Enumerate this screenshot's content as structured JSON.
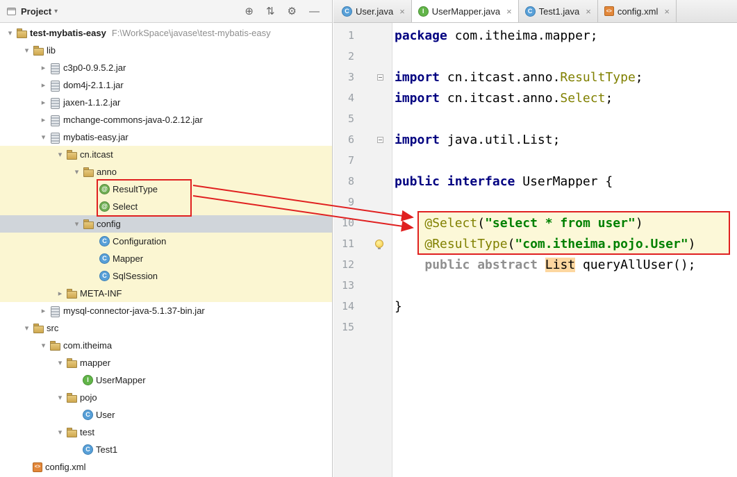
{
  "panel": {
    "title": "Project",
    "header_icons": [
      {
        "name": "locate",
        "glyph": "⊕"
      },
      {
        "name": "collapse-all",
        "glyph": "⇅"
      },
      {
        "name": "settings",
        "glyph": "⚙"
      },
      {
        "name": "hide",
        "glyph": "—"
      }
    ],
    "tree": [
      {
        "label": "test-mybatis-easy",
        "sub": "F:\\WorkSpace\\javase\\test-mybatis-easy",
        "icon": "folder",
        "level": 0,
        "chevron": "expanded",
        "bold": true
      },
      {
        "label": "lib",
        "icon": "folder",
        "level": 1,
        "chevron": "expanded"
      },
      {
        "label": "c3p0-0.9.5.2.jar",
        "icon": "jar",
        "level": 2,
        "chevron": "collapsed"
      },
      {
        "label": "dom4j-2.1.1.jar",
        "icon": "jar",
        "level": 2,
        "chevron": "collapsed"
      },
      {
        "label": "jaxen-1.1.2.jar",
        "icon": "jar",
        "level": 2,
        "chevron": "collapsed"
      },
      {
        "label": "mchange-commons-java-0.2.12.jar",
        "icon": "jar",
        "level": 2,
        "chevron": "collapsed"
      },
      {
        "label": "mybatis-easy.jar",
        "icon": "jar",
        "level": 2,
        "chevron": "expanded"
      },
      {
        "label": "cn.itcast",
        "icon": "folder",
        "level": 3,
        "chevron": "expanded",
        "bg": "yellow"
      },
      {
        "label": "anno",
        "icon": "folder",
        "level": 4,
        "chevron": "expanded",
        "bg": "yellow"
      },
      {
        "label": "ResultType",
        "icon": "annotation",
        "level": 5,
        "bg": "yellow"
      },
      {
        "label": "Select",
        "icon": "annotation",
        "level": 5,
        "bg": "yellow"
      },
      {
        "label": "config",
        "icon": "folder",
        "level": 4,
        "chevron": "expanded",
        "bg": "selected"
      },
      {
        "label": "Configuration",
        "icon": "class",
        "level": 5,
        "bg": "yellow"
      },
      {
        "label": "Mapper",
        "icon": "class",
        "level": 5,
        "bg": "yellow"
      },
      {
        "label": "SqlSession",
        "icon": "class",
        "level": 5,
        "bg": "yellow"
      },
      {
        "label": "META-INF",
        "icon": "folder",
        "level": 3,
        "chevron": "collapsed",
        "bg": "yellow"
      },
      {
        "label": "mysql-connector-java-5.1.37-bin.jar",
        "icon": "jar",
        "level": 2,
        "chevron": "collapsed"
      },
      {
        "label": "src",
        "icon": "folder",
        "level": 1,
        "chevron": "expanded"
      },
      {
        "label": "com.itheima",
        "icon": "folder",
        "level": 2,
        "chevron": "expanded"
      },
      {
        "label": "mapper",
        "icon": "folder",
        "level": 3,
        "chevron": "expanded"
      },
      {
        "label": "UserMapper",
        "icon": "interface",
        "level": 4
      },
      {
        "label": "pojo",
        "icon": "folder",
        "level": 3,
        "chevron": "expanded"
      },
      {
        "label": "User",
        "icon": "class",
        "level": 4
      },
      {
        "label": "test",
        "icon": "folder",
        "level": 3,
        "chevron": "expanded"
      },
      {
        "label": "Test1",
        "icon": "class",
        "level": 4
      },
      {
        "label": "config.xml",
        "icon": "xml",
        "level": 1
      }
    ]
  },
  "tabbar": {
    "close_glyph": "×",
    "tabs": [
      {
        "label": "User.java",
        "icon": "class",
        "active": false
      },
      {
        "label": "UserMapper.java",
        "icon": "interface",
        "active": true
      },
      {
        "label": "Test1.java",
        "icon": "class",
        "active": false
      },
      {
        "label": "config.xml",
        "icon": "xml",
        "active": false
      }
    ]
  },
  "editor": {
    "lines": [
      {
        "num": "1",
        "segs": [
          {
            "t": "package",
            "s": "kw"
          },
          {
            "t": " com.itheima.mapper;",
            "s": "p"
          }
        ]
      },
      {
        "num": "2",
        "segs": []
      },
      {
        "num": "3",
        "gutter": "fold",
        "segs": [
          {
            "t": "import",
            "s": "kw"
          },
          {
            "t": " cn.itcast.anno.",
            "s": "p"
          },
          {
            "t": "ResultType",
            "s": "ann"
          },
          {
            "t": ";",
            "s": "p"
          }
        ]
      },
      {
        "num": "4",
        "segs": [
          {
            "t": "import",
            "s": "kw"
          },
          {
            "t": " cn.itcast.anno.",
            "s": "p"
          },
          {
            "t": "Select",
            "s": "ann"
          },
          {
            "t": ";",
            "s": "p"
          }
        ]
      },
      {
        "num": "5",
        "segs": []
      },
      {
        "num": "6",
        "gutter": "fold",
        "segs": [
          {
            "t": "import",
            "s": "kw"
          },
          {
            "t": " java.util.List;",
            "s": "p"
          }
        ]
      },
      {
        "num": "7",
        "segs": []
      },
      {
        "num": "8",
        "segs": [
          {
            "t": "public interface",
            "s": "kw"
          },
          {
            "t": " UserMapper {",
            "s": "p"
          }
        ]
      },
      {
        "num": "9",
        "segs": []
      },
      {
        "num": "10",
        "segs": [
          {
            "t": "    ",
            "s": "p"
          },
          {
            "t": "@Select",
            "s": "ann"
          },
          {
            "t": "(",
            "s": "p"
          },
          {
            "t": "\"select * from user\"",
            "s": "str"
          },
          {
            "t": ")",
            "s": "p"
          }
        ]
      },
      {
        "num": "11",
        "gutter": "bulb",
        "segs": [
          {
            "t": "    ",
            "s": "p"
          },
          {
            "t": "@ResultType",
            "s": "ann"
          },
          {
            "t": "(",
            "s": "p"
          },
          {
            "t": "\"com.itheima.pojo.User\"",
            "s": "str"
          },
          {
            "t": ")",
            "s": "p"
          }
        ]
      },
      {
        "num": "12",
        "segs": [
          {
            "t": "    ",
            "s": "p"
          },
          {
            "t": "public abstract",
            "s": "gray"
          },
          {
            "t": " ",
            "s": "p"
          },
          {
            "t": "List",
            "s": "hl"
          },
          {
            "t": " queryAllUser();",
            "s": "p"
          }
        ]
      },
      {
        "num": "13",
        "segs": []
      },
      {
        "num": "14",
        "segs": [
          {
            "t": "}",
            "s": "p"
          }
        ]
      },
      {
        "num": "15",
        "segs": []
      }
    ]
  },
  "glyphs": {
    "chevron_expanded": "▾",
    "chevron_collapsed": "▸",
    "project_caret": "▾",
    "class_letter": "C",
    "interface_letter": "I",
    "annotation_at": "@",
    "xml_mark": "<>"
  },
  "colors": {
    "accent_red": "#e02020",
    "tree_highlight_bg": "#fbf6d2",
    "tree_selection_bg": "#d0d5da",
    "keyword": "#000080",
    "string": "#008000",
    "annotation": "#808000",
    "identifier_highlight_bg": "#fdd7a0"
  }
}
